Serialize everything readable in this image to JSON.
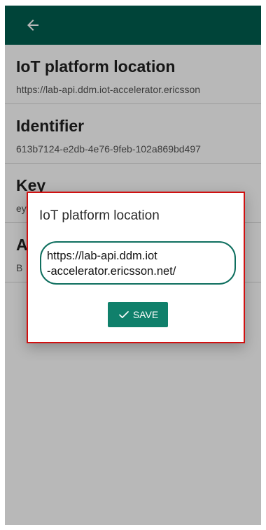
{
  "appbar": {
    "back_icon": "arrow-left-icon",
    "color": "#005f4f"
  },
  "settings": {
    "items": [
      {
        "title": "IoT platform location",
        "value": "https://lab-api.ddm.iot-accelerator.ericsson"
      },
      {
        "title": "Identifier",
        "value": "613b7124-e2db-4e76-9feb-102a869bd497"
      },
      {
        "title": "Key",
        "value": "ey"
      },
      {
        "title": "A",
        "value": "B"
      }
    ]
  },
  "dialog": {
    "title": "IoT platform location",
    "url_line1": "https://lab-api.ddm.iot",
    "url_line2": "-accelerator.ericsson.net/",
    "save_label": "SAVE",
    "save_icon": "check-icon",
    "accent": "#10806b",
    "highlight": "#d01010"
  }
}
